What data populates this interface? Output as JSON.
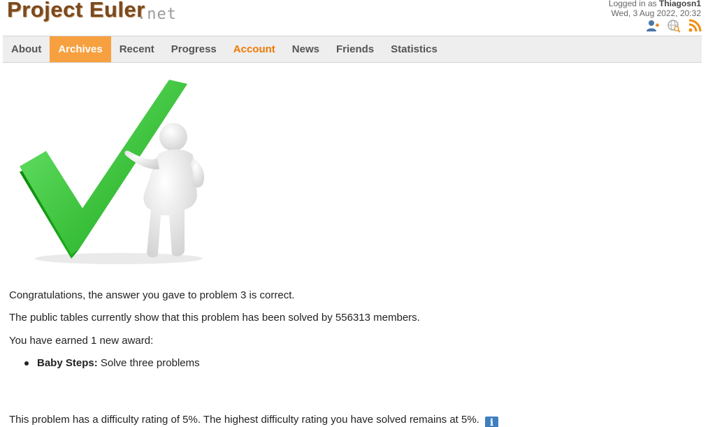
{
  "header": {
    "logo_main": "Project Euler",
    "logo_suffix": ".net",
    "logged_in_prefix": "Logged in as",
    "username": "Thiagosn1",
    "datetime": "Wed, 3 Aug 2022, 20:32",
    "icons": [
      "add-friend-icon",
      "globe-search-icon",
      "rss-icon"
    ]
  },
  "nav": {
    "items": [
      {
        "label": "About"
      },
      {
        "label": "Archives"
      },
      {
        "label": "Recent"
      },
      {
        "label": "Progress"
      },
      {
        "label": "Account"
      },
      {
        "label": "News"
      },
      {
        "label": "Friends"
      },
      {
        "label": "Statistics"
      }
    ]
  },
  "main": {
    "congrats": "Congratulations, the answer you gave to problem 3 is correct.",
    "solved_by": "The public tables currently show that this problem has been solved by 556313 members.",
    "award_intro": "You have earned 1 new award:",
    "award_name": "Baby Steps:",
    "award_desc": "Solve three problems",
    "difficulty": "This problem has a difficulty rating of 5%. The highest difficulty rating you have solved remains at 5%."
  },
  "colors": {
    "accent": "#f07800",
    "active_tab": "#f7a040",
    "logo": "#7a4a1f",
    "check_green": "#2ec22e"
  }
}
